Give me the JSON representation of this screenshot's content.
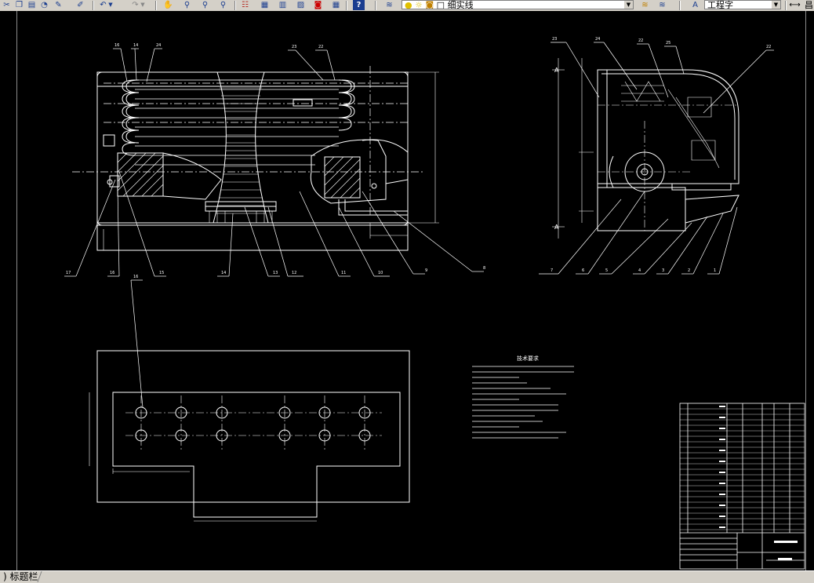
{
  "toolbar": {
    "linetype_combo": "细实线",
    "textstyle_combo": "工程字",
    "overflow_glyph": "昌"
  },
  "icons": [
    "scissors-icon",
    "copy-icon",
    "paste-icon",
    "matchprop-icon",
    "brush-icon",
    "undo-icon",
    "redo-icon",
    "pan-icon",
    "zoom-realtime-icon",
    "zoom-window-icon",
    "zoom-previous-icon",
    "properties-icon",
    "designcenter-icon",
    "toolpalette-icon",
    "sheetset-icon",
    "markup-icon",
    "calculator-icon",
    "help-icon",
    "layer-manager-icon",
    "bulb-icon",
    "sun-icon",
    "lock-icon",
    "color-square-icon",
    "layer-previous-icon",
    "layer-state-icon",
    "textstyle-icon"
  ],
  "tabs": {
    "current_label": "标题栏"
  },
  "drawing": {
    "section_mark": "A",
    "tech_title": "技术要求",
    "tech_lines": [
      "1.",
      "2.",
      "3.",
      "4.",
      "5.",
      "6.",
      "7.",
      "8.",
      "9.",
      "10.",
      "11.",
      "12."
    ],
    "front_callouts": [
      "17",
      "16",
      "15",
      "14",
      "13",
      "12",
      "11",
      "10",
      "9",
      "8"
    ],
    "side_callouts": [
      "7",
      "6",
      "5",
      "4",
      "3",
      "2",
      "1"
    ]
  }
}
